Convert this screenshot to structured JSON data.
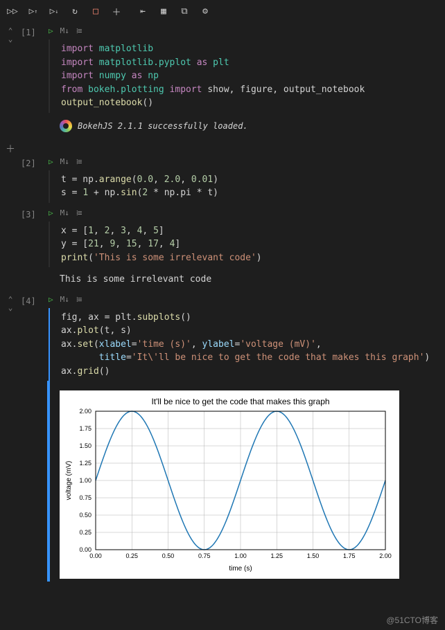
{
  "toolbar": {
    "icons": [
      "run-all",
      "run-above",
      "run-below",
      "restart",
      "stop",
      "add",
      "outdent",
      "grid",
      "copy",
      "settings"
    ]
  },
  "cells": [
    {
      "label": "[1]",
      "md": "M↓",
      "code_html": "<span class='kw'>import</span> <span class='mod'>matplotlib</span>\n<span class='kw'>import</span> <span class='mod'>matplotlib.pyplot</span> <span class='kw'>as</span> <span class='mod'>plt</span>\n<span class='kw'>import</span> <span class='mod'>numpy</span> <span class='kw'>as</span> <span class='mod'>np</span>\n<span class='kw'>from</span> <span class='mod'>bokeh.plotting</span> <span class='kw'>import</span> show, figure, output_notebook\n<span class='fn'>output_notebook</span>()",
      "output": {
        "type": "bokeh",
        "text": "BokehJS 2.1.1 successfully loaded."
      }
    },
    {
      "label": "[2]",
      "md": "M↓",
      "code_html": "t = np.<span class='fn'>arange</span>(<span class='num'>0.0</span>, <span class='num'>2.0</span>, <span class='num'>0.01</span>)\ns = <span class='num'>1</span> + np.<span class='fn'>sin</span>(<span class='num'>2</span> * np.pi * t)"
    },
    {
      "label": "[3]",
      "md": "M↓",
      "code_html": "x = [<span class='num'>1</span>, <span class='num'>2</span>, <span class='num'>3</span>, <span class='num'>4</span>, <span class='num'>5</span>]\ny = [<span class='num'>21</span>, <span class='num'>9</span>, <span class='num'>15</span>, <span class='num'>17</span>, <span class='num'>4</span>]\n<span class='fn'>print</span>(<span class='str'>'This is some irrelevant code'</span>)",
      "output": {
        "type": "text",
        "text": "This is some irrelevant code"
      }
    },
    {
      "label": "[4]",
      "md": "M↓",
      "active": true,
      "code_html": "fig, ax = plt.<span class='fn'>subplots</span>()\nax.<span class='fn'>plot</span>(t, s)\nax.<span class='fn'>set</span>(<span class='param'>xlabel</span>=<span class='str'>'time (s)'</span>, <span class='param'>ylabel</span>=<span class='str'>'voltage (mV)'</span>,\n       <span class='param'>title</span>=<span class='str'>'It\\'ll be nice to get the code that makes this graph'</span>)\nax.<span class='fn'>grid</span>()",
      "output": {
        "type": "chart"
      }
    }
  ],
  "chart_data": {
    "type": "line",
    "title": "It'll be nice to get the code that makes this graph",
    "xlabel": "time (s)",
    "ylabel": "voltage (mV)",
    "xlim": [
      0.0,
      2.0
    ],
    "ylim": [
      0.0,
      2.0
    ],
    "xticks": [
      "0.00",
      "0.25",
      "0.50",
      "0.75",
      "1.00",
      "1.25",
      "1.50",
      "1.75",
      "2.00"
    ],
    "yticks": [
      "0.00",
      "0.25",
      "0.50",
      "0.75",
      "1.00",
      "1.25",
      "1.50",
      "1.75",
      "2.00"
    ],
    "formula": "s = 1 + sin(2*pi*t)",
    "x_step": 0.01,
    "series": [
      {
        "name": "voltage",
        "expression": "1 + sin(2*pi*t)",
        "t_range": [
          0.0,
          2.0
        ]
      }
    ]
  },
  "watermark": "@51CTO博客"
}
